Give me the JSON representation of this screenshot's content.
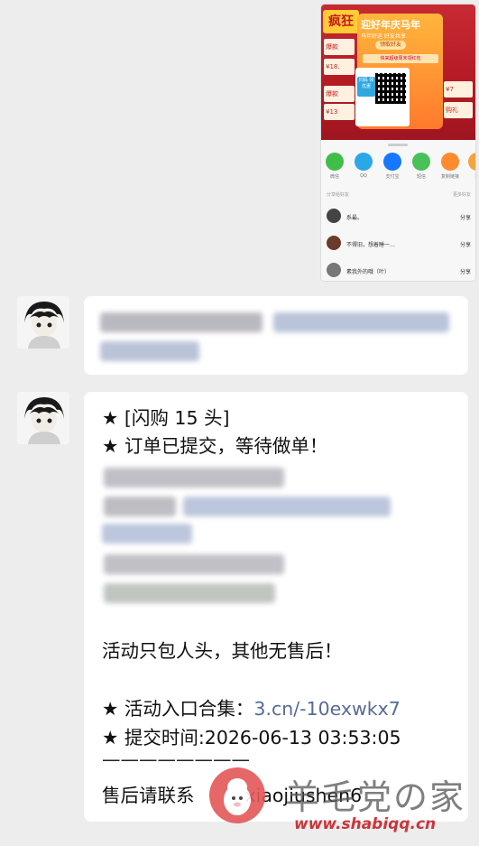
{
  "shared_image": {
    "banner_badge": "疯狂",
    "card_title": "迎好年庆马年",
    "card_subtitle": "马年好运 好友共享",
    "card_button": "领取好友",
    "card_banner": "快来超级周末领红包",
    "qr_tag": "扫码\n领优惠",
    "side_left_1": "爆款",
    "side_left_2": "¥18.",
    "side_left_3": "爆款",
    "side_left_4": "¥13",
    "side_right_1": "¥7",
    "side_right_2": "购礼",
    "share_targets": [
      {
        "label": "微信",
        "color": "#3fbf4a"
      },
      {
        "label": "QQ",
        "color": "#2aa7e6"
      },
      {
        "label": "支付宝",
        "color": "#1677ff"
      },
      {
        "label": "短信",
        "color": "#49c05a"
      },
      {
        "label": "复制链接",
        "color": "#ff8a30"
      },
      {
        "label": "微",
        "color": "#f3a43b"
      }
    ],
    "share_head_left": "分享给好友",
    "share_head_right": "更多好友",
    "chat_rows": [
      {
        "name": "系最。",
        "action": "分享"
      },
      {
        "name": "不得旧，想着睡一…",
        "action": "分享"
      },
      {
        "name": "素我外的哦（叶）",
        "action": "分享"
      }
    ]
  },
  "messages": [
    {
      "avatar": "anime-boy-avatar"
    },
    {
      "avatar": "anime-boy-avatar",
      "lines": [
        "★ [闪购 15 头]",
        "★ 订单已提交，等待做单！"
      ],
      "lines_after": [
        "活动只包人头，其他无售后！",
        "★ 活动入口合集：",
        "★ 提交时间:2026-06-13 03:53:05",
        "————————",
        "售后请联系"
      ],
      "link": "3.cn/-10exwkx7",
      "contact": "xiaojiushen6"
    }
  ],
  "watermark": {
    "text": "羊毛党の家",
    "url": "www.shabiqq.cn"
  }
}
